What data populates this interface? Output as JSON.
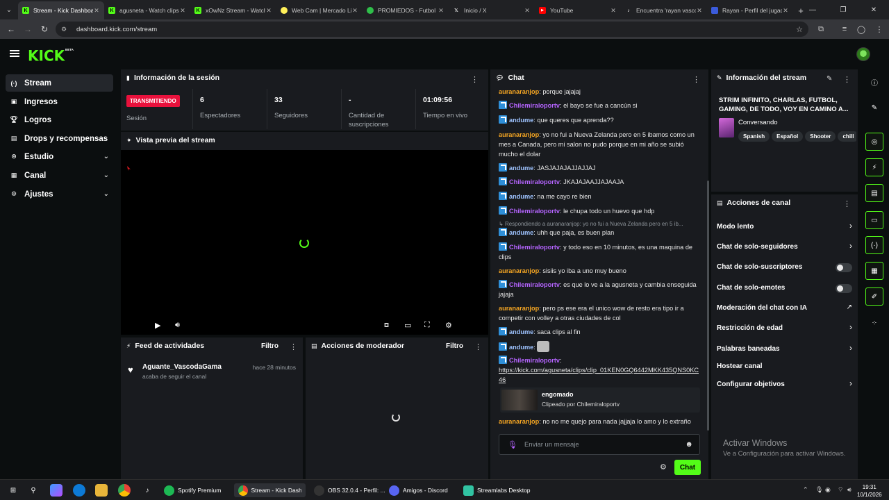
{
  "browser": {
    "tabs": [
      {
        "title": "Stream - Kick Dashboard",
        "active": true,
        "icon": "kick-icon"
      },
      {
        "title": "agusneta - Watch clips",
        "icon": "kick-icon"
      },
      {
        "title": "xOwNz Stream - Watch",
        "icon": "kick-icon"
      },
      {
        "title": "Web Cam | Mercado Libre",
        "icon": "mercadolibre-icon"
      },
      {
        "title": "PROMIEDOS - Futbol",
        "icon": "promiedos-icon"
      },
      {
        "title": "Inicio / X",
        "icon": "x-icon"
      },
      {
        "title": "YouTube",
        "icon": "youtube-icon"
      },
      {
        "title": "Encuentra 'rayan vasco'",
        "icon": "tiktok-icon"
      },
      {
        "title": "Rayan - Perfil del jugador",
        "icon": "profile-icon"
      }
    ],
    "url": "dashboard.kick.com/stream"
  },
  "brand": {
    "logo": "KICK",
    "beta": "BETA",
    "accent": "#53fc18"
  },
  "sidebar": {
    "items": [
      {
        "label": "Stream",
        "icon": "broadcast-icon",
        "active": true
      },
      {
        "label": "Ingresos",
        "icon": "money-icon"
      },
      {
        "label": "Logros",
        "icon": "trophy-icon"
      },
      {
        "label": "Drops y recompensas",
        "icon": "gift-icon"
      },
      {
        "label": "Estudio",
        "icon": "studio-icon",
        "expandable": true
      },
      {
        "label": "Canal",
        "icon": "channel-icon",
        "expandable": true
      },
      {
        "label": "Ajustes",
        "icon": "gear-icon",
        "expandable": true
      }
    ]
  },
  "session": {
    "title": "Información de la sesión",
    "status": "TRANSMITIENDO",
    "status_label": "Sesión",
    "viewers": "6",
    "viewers_label": "Espectadores",
    "followers": "33",
    "followers_label": "Seguidores",
    "subs": "-",
    "subs_label": "Cantidad de suscripciones",
    "uptime": "01:09:56",
    "uptime_label": "Tiempo en vivo"
  },
  "preview": {
    "title": "Vista previa del stream"
  },
  "feed": {
    "title": "Feed de actividades",
    "filter": "Filtro",
    "items": [
      {
        "user": "Aguante_VascodaGama",
        "action": "acaba de seguir el canal",
        "time": "hace 28 minutos"
      }
    ]
  },
  "modactions": {
    "title": "Acciones de moderador",
    "filter": "Filtro"
  },
  "chat": {
    "title": "Chat",
    "messages": [
      {
        "user": "auranaranjop",
        "text": "porque jajajaj"
      },
      {
        "user": "Chilemiraloportv",
        "text": "el bayo se fue a cancún si"
      },
      {
        "user": "andume",
        "text": "que queres que aprenda??"
      },
      {
        "user": "auranaranjop",
        "text": "yo no fui a Nueva Zelanda pero en 5 ibamos como un mes a Canada, pero mi salon no pudo porque en mi año se subió mucho el dolar"
      },
      {
        "user": "andume",
        "text": "JASJAJAJAJJAJJAJ"
      },
      {
        "user": "Chilemiraloportv",
        "text": "JKAJAJAAJJAJAAJA"
      },
      {
        "user": "andume",
        "text": "na me cayo re bien"
      },
      {
        "user": "Chilemiraloportv",
        "text": "le chupa todo un huevo que hdp"
      },
      {
        "user": "andume",
        "text": "uhh que paja, es buen plan",
        "reply": "Respondiendo a auranaranjop: yo no fui a Nueva Zelanda pero en 5 ib..."
      },
      {
        "user": "Chilemiraloportv",
        "text": "y todo eso en 10 minutos, es una maquina de clips"
      },
      {
        "user": "auranaranjop",
        "text": "sisiis yo iba a uno muy bueno"
      },
      {
        "user": "Chilemiraloportv",
        "text": "es que lo ve a la agusneta y cambia enseguida jajaja"
      },
      {
        "user": "auranaranjop",
        "text": "pero ps ese era el unico wow de resto era tipo ir a competir con volley a otras ciudades de col"
      },
      {
        "user": "andume",
        "text": "saca clips al fin"
      },
      {
        "user": "andume",
        "text": ""
      },
      {
        "user": "Chilemiraloportv",
        "text": ""
      },
      {
        "user": "auranaranjop",
        "text": "no no me quejo para nada jajjaja lo amo y lo extraño"
      }
    ],
    "link": "https://kick.com/agusneta/clips/clip_01KEN0GQ6442MKK435QNS0KC46",
    "clip": {
      "title": "engomado",
      "by": "Clipeado por Chilemiraloportv"
    },
    "input_placeholder": "Enviar un mensaje",
    "send": "Chat"
  },
  "streaminfo": {
    "title": "Información del stream",
    "stream_title": "STRIM INFINITO, CHARLAS, FUTBOL, GAMING, DE TODO, VOY EN CAMINO A...",
    "category": "Conversando",
    "tags": [
      "Spanish",
      "Español",
      "Shooter",
      "chill"
    ]
  },
  "channelactions": {
    "title": "Acciones de canal",
    "items": [
      {
        "label": "Modo lento",
        "kind": "chevron"
      },
      {
        "label": "Chat de solo-seguidores",
        "kind": "chevron"
      },
      {
        "label": "Chat de solo-suscriptores",
        "kind": "toggle",
        "on": false
      },
      {
        "label": "Chat de solo-emotes",
        "kind": "toggle",
        "on": false
      },
      {
        "label": "Moderación del chat con IA",
        "kind": "external"
      },
      {
        "label": "Restricción de edad",
        "kind": "chevron"
      },
      {
        "label": "Palabras baneadas",
        "kind": "chevron"
      },
      {
        "label": "Hostear canal",
        "kind": "none"
      },
      {
        "label": "Configurar objetivos",
        "kind": "chevron"
      }
    ]
  },
  "windows_watermark": {
    "line1": "Activar Windows",
    "line2": "Ve a Configuración para activar Windows."
  },
  "taskbar": {
    "apps": [
      "Spotify Premium",
      "Stream - Kick Dash...",
      "OBS 32.0.4 - Perfil: ...",
      "Amigos - Discord",
      "Streamlabs Desktop"
    ],
    "time": "19:31",
    "date": "10/1/2026"
  }
}
